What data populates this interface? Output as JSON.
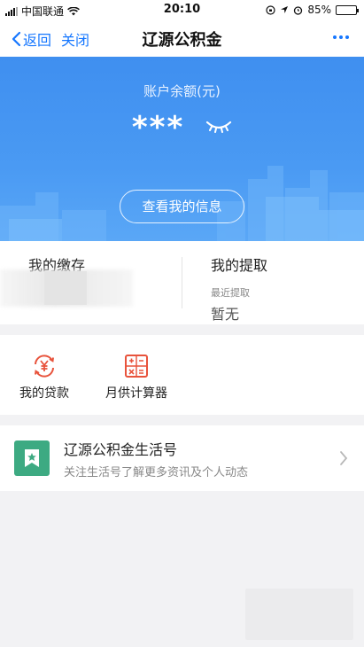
{
  "status_bar": {
    "carrier": "中国联通",
    "time": "20:10",
    "battery": "85%",
    "battery_level": 0.85
  },
  "nav": {
    "back_label": "返回",
    "close_label": "关闭",
    "title": "辽源公积金",
    "accent_color": "#1677ff"
  },
  "banner": {
    "balance_label": "账户余额(元)",
    "balance_masked": "***",
    "view_button_label": "查看我的信息",
    "background_color": "#4a9af3"
  },
  "summary": {
    "deposit_title": "我的缴存",
    "withdraw_title": "我的提取",
    "withdraw_sub": "最近提取",
    "withdraw_value": "暂无"
  },
  "tools": [
    {
      "label": "我的贷款",
      "icon": "loan-yuan-icon"
    },
    {
      "label": "月供计算器",
      "icon": "calculator-icon"
    }
  ],
  "service_card": {
    "title": "辽源公积金生活号",
    "description": "关注生活号了解更多资讯及个人动态",
    "icon": "bookmark-star-icon",
    "icon_color": "#3daa82"
  }
}
